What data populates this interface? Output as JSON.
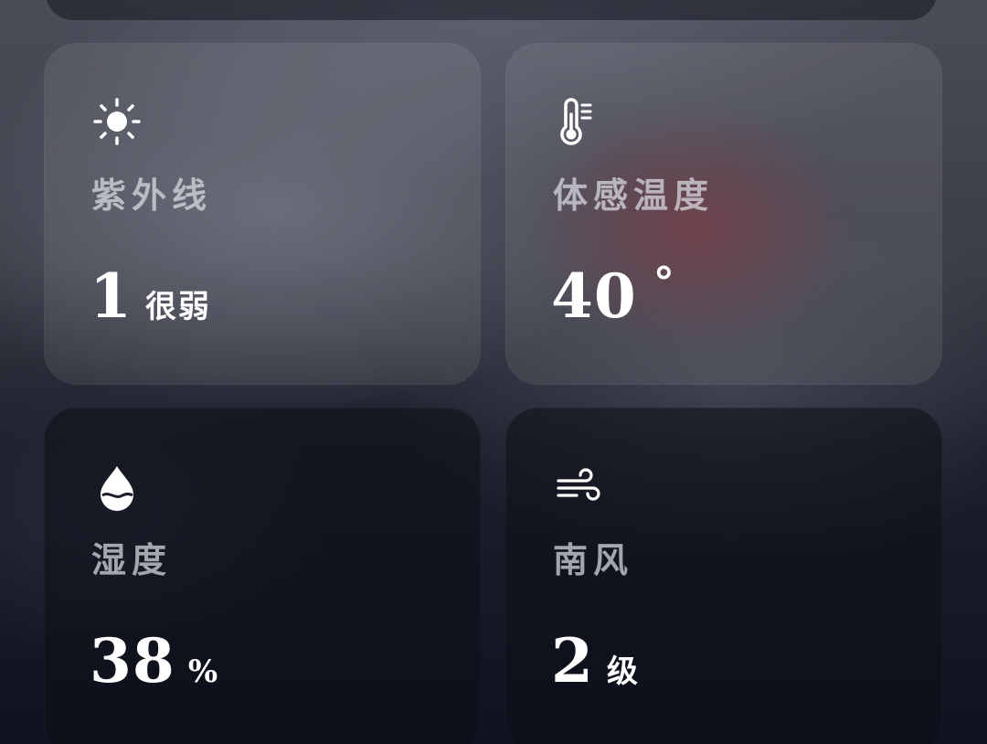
{
  "cards": {
    "uv": {
      "icon": "sun-icon",
      "label": "紫外线",
      "value": "1",
      "unit": "很弱"
    },
    "feels_like": {
      "icon": "thermometer-icon",
      "label": "体感温度",
      "value": "40",
      "unit": "°"
    },
    "humidity": {
      "icon": "water-drop-icon",
      "label": "湿度",
      "value": "38",
      "unit": "%"
    },
    "wind": {
      "icon": "wind-icon",
      "label": "南风",
      "value": "2",
      "unit": "级"
    }
  },
  "colors": {
    "label": "#c8cad2",
    "value": "#ffffff",
    "card_light": "rgba(255,255,255,0.08)",
    "card_dark": "rgba(12,14,24,0.55)"
  }
}
